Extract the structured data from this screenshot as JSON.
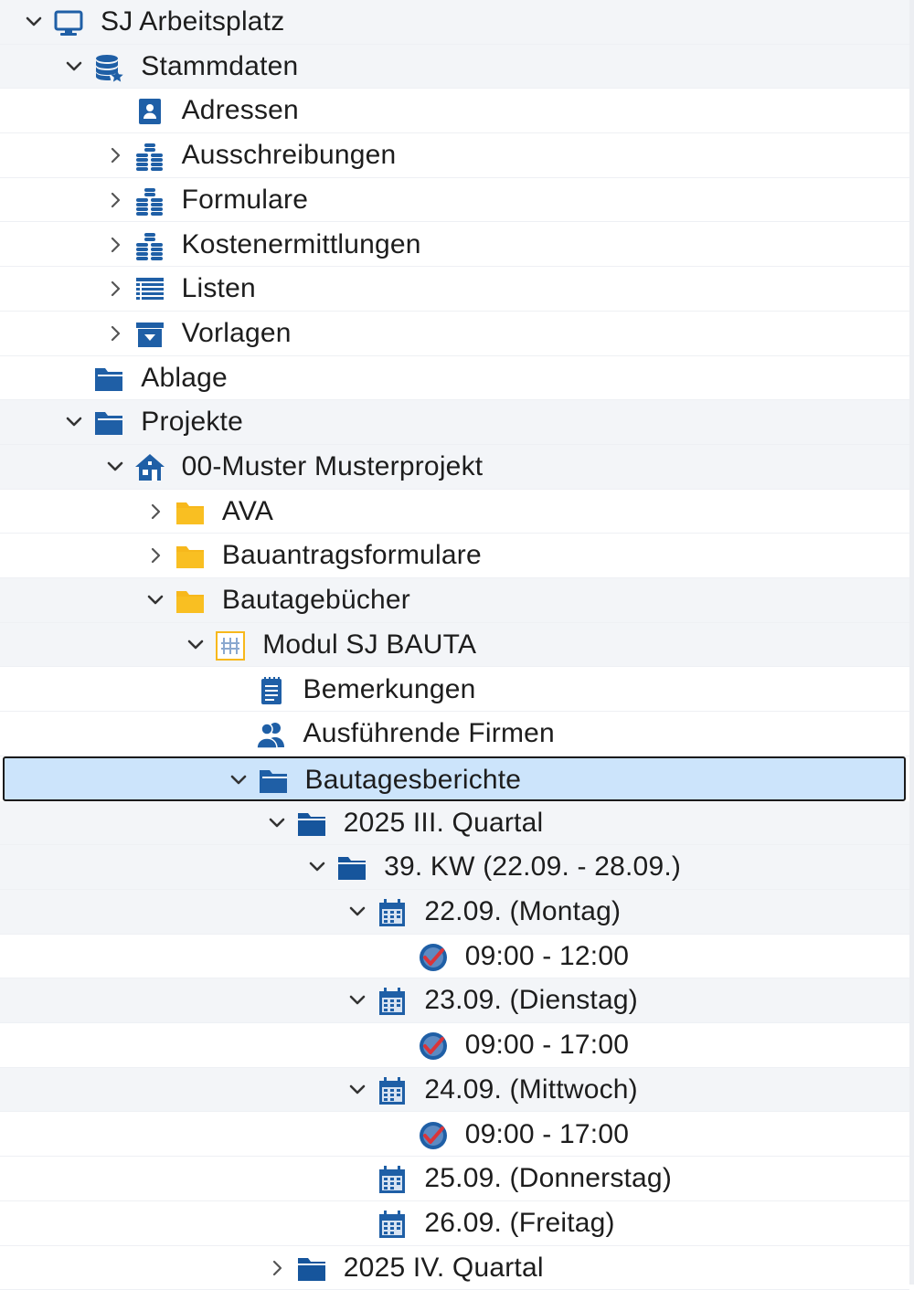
{
  "tree": {
    "nodes": [
      {
        "label": "SJ Arbeitsplatz",
        "depth": 0,
        "state": "expanded",
        "icon": "monitor-icon"
      },
      {
        "label": "Stammdaten",
        "depth": 1,
        "state": "expanded",
        "icon": "database-icon"
      },
      {
        "label": "Adressen",
        "depth": 2,
        "state": "leaf",
        "icon": "address-book-icon"
      },
      {
        "label": "Ausschreibungen",
        "depth": 2,
        "state": "collapsed",
        "icon": "coin-stack-icon"
      },
      {
        "label": "Formulare",
        "depth": 2,
        "state": "collapsed",
        "icon": "coin-stack-icon"
      },
      {
        "label": "Kostenermittlungen",
        "depth": 2,
        "state": "collapsed",
        "icon": "coin-stack-icon"
      },
      {
        "label": "Listen",
        "depth": 2,
        "state": "collapsed",
        "icon": "list-icon"
      },
      {
        "label": "Vorlagen",
        "depth": 2,
        "state": "collapsed",
        "icon": "template-box-icon"
      },
      {
        "label": "Ablage",
        "depth": 1,
        "state": "leaf",
        "icon": "folder-blue-icon"
      },
      {
        "label": "Projekte",
        "depth": 1,
        "state": "expanded",
        "icon": "folder-blue-icon"
      },
      {
        "label": "00-Muster Musterprojekt",
        "depth": 2,
        "state": "expanded",
        "icon": "house-icon"
      },
      {
        "label": "AVA",
        "depth": 3,
        "state": "collapsed",
        "icon": "folder-yellow-icon"
      },
      {
        "label": "Bauantragsformulare",
        "depth": 3,
        "state": "collapsed",
        "icon": "folder-yellow-icon"
      },
      {
        "label": "Bautagebücher",
        "depth": 3,
        "state": "expanded",
        "icon": "folder-yellow-icon"
      },
      {
        "label": "Modul SJ BAUTA",
        "depth": 4,
        "state": "expanded",
        "icon": "module-icon"
      },
      {
        "label": "Bemerkungen",
        "depth": 5,
        "state": "leaf",
        "icon": "notes-icon"
      },
      {
        "label": "Ausführende Firmen",
        "depth": 5,
        "state": "leaf",
        "icon": "people-icon"
      },
      {
        "label": "Bautagesberichte",
        "depth": 5,
        "state": "expanded",
        "icon": "folder-blue-icon",
        "selected": true
      },
      {
        "label": "2025 III. Quartal",
        "depth": 6,
        "state": "expanded",
        "icon": "folder-dark-icon"
      },
      {
        "label": "39. KW (22.09. - 28.09.)",
        "depth": 7,
        "state": "expanded",
        "icon": "folder-dark-icon"
      },
      {
        "label": "22.09. (Montag)",
        "depth": 8,
        "state": "expanded",
        "icon": "calendar-icon"
      },
      {
        "label": "09:00 - 12:00",
        "depth": 9,
        "state": "leaf",
        "icon": "check-clock-icon"
      },
      {
        "label": "23.09. (Dienstag)",
        "depth": 8,
        "state": "expanded",
        "icon": "calendar-icon"
      },
      {
        "label": "09:00 - 17:00",
        "depth": 9,
        "state": "leaf",
        "icon": "check-clock-icon"
      },
      {
        "label": "24.09. (Mittwoch)",
        "depth": 8,
        "state": "expanded",
        "icon": "calendar-icon"
      },
      {
        "label": "09:00 - 17:00",
        "depth": 9,
        "state": "leaf",
        "icon": "check-clock-icon"
      },
      {
        "label": "25.09. (Donnerstag)",
        "depth": 8,
        "state": "leaf",
        "icon": "calendar-icon"
      },
      {
        "label": "26.09. (Freitag)",
        "depth": 8,
        "state": "leaf",
        "icon": "calendar-icon"
      },
      {
        "label": "2025 IV. Quartal",
        "depth": 6,
        "state": "collapsed",
        "icon": "folder-dark-icon"
      }
    ]
  },
  "colors": {
    "icon_blue": "#1f5fa6",
    "folder_yellow": "#f7b81c",
    "selection_bg": "#cce4fb",
    "check_red": "#d9343a"
  }
}
